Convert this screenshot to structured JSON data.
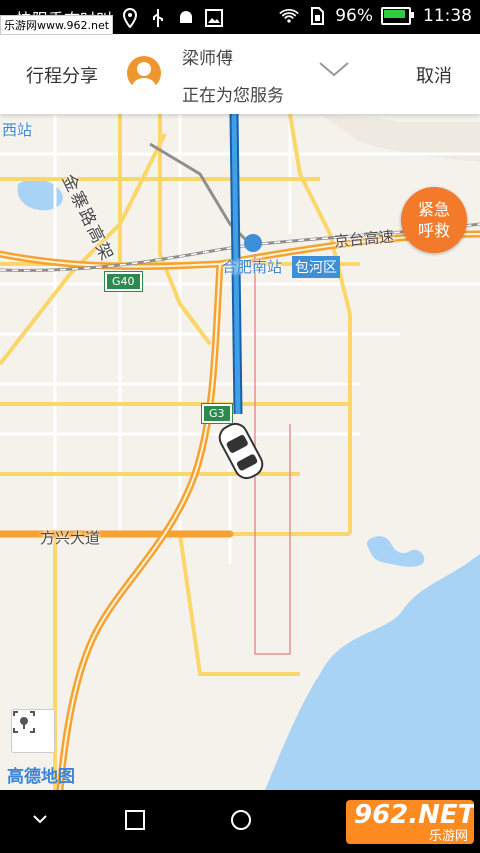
{
  "status_bar": {
    "watermark": "乐游网www.962.net",
    "truncated_title": "快限乘态时叫",
    "battery_percent": "96%",
    "battery_level": 0.96,
    "time": "11:38",
    "icons": [
      "location-icon",
      "usb-icon",
      "android-icon",
      "image-icon",
      "wifi-icon",
      "sim-icon",
      "battery-icon"
    ]
  },
  "header": {
    "share_label": "行程分享",
    "driver_name": "梁师傅",
    "driver_status": "正在为您服务",
    "cancel_label": "取消",
    "avatar_color": "#f0962e"
  },
  "map": {
    "labels": {
      "west_station": "西站",
      "jinzhai_road": "金寨路高架",
      "hefei_south": "合肥南站",
      "baohe": "包河区",
      "jingtai": "京台高速",
      "fangxing": "方兴大道",
      "g40": "G40",
      "g3": "G3"
    },
    "emergency_line1": "紧急",
    "emergency_line2": "呼救",
    "emergency_color": "#f37a2a",
    "logo": "高德地图",
    "route_color": "#2f7fc9",
    "water_color": "#a9d3f5"
  },
  "watermark_bottom": {
    "brand": "962.NET",
    "sub": "乐游网"
  }
}
